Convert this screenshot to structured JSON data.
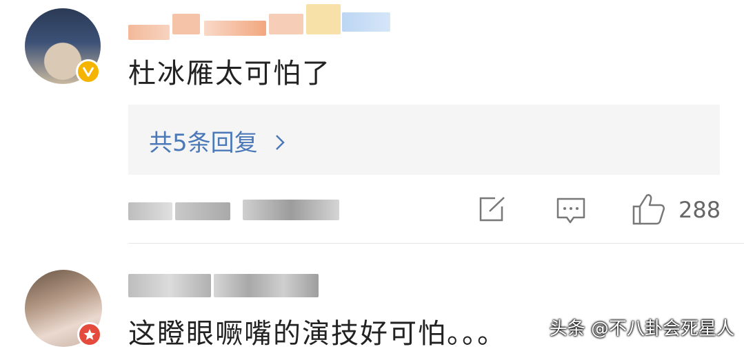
{
  "comments": [
    {
      "text": "杜冰雁太可怕了",
      "reply_link": "共5条回复",
      "like_count": "288"
    },
    {
      "text": "这瞪眼噘嘴的演技好可怕。。。"
    }
  ],
  "icons": {
    "verified": "verified-v-icon",
    "share": "share-icon",
    "comment": "comment-icon",
    "like": "thumbs-up-icon",
    "chevron": "chevron-right-icon",
    "member": "star-badge-icon"
  },
  "watermark": "头条 @不八卦会死星人",
  "colors": {
    "link": "#4a78b8",
    "verified_badge": "#f5b400",
    "member_badge": "#e54b3c"
  }
}
